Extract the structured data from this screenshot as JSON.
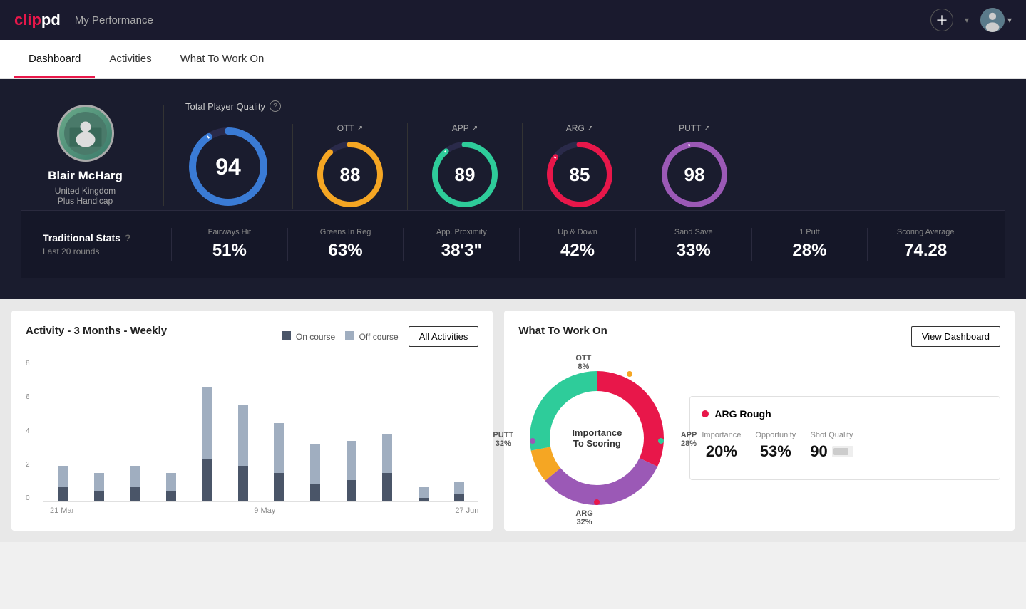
{
  "app": {
    "logo_text": "clippd",
    "logo_highlight": "clip",
    "header_title": "My Performance"
  },
  "nav": {
    "tabs": [
      "Dashboard",
      "Activities",
      "What To Work On"
    ],
    "active_tab": "Dashboard"
  },
  "player": {
    "name": "Blair McHarg",
    "country": "United Kingdom",
    "handicap": "Plus Handicap"
  },
  "quality": {
    "section_label": "Total Player Quality",
    "main_score": 94,
    "scores": [
      {
        "label": "OTT",
        "value": 88,
        "color": "#f5a623",
        "track": "#3a3a3a"
      },
      {
        "label": "APP",
        "value": 89,
        "color": "#2ecc9a",
        "track": "#3a3a3a"
      },
      {
        "label": "ARG",
        "value": 85,
        "color": "#e8174a",
        "track": "#3a3a3a"
      },
      {
        "label": "PUTT",
        "value": 98,
        "color": "#9b59b6",
        "track": "#3a3a3a"
      }
    ]
  },
  "traditional_stats": {
    "title": "Traditional Stats",
    "subtitle": "Last 20 rounds",
    "stats": [
      {
        "label": "Fairways Hit",
        "value": "51%"
      },
      {
        "label": "Greens In Reg",
        "value": "63%"
      },
      {
        "label": "App. Proximity",
        "value": "38'3\""
      },
      {
        "label": "Up & Down",
        "value": "42%"
      },
      {
        "label": "Sand Save",
        "value": "33%"
      },
      {
        "label": "1 Putt",
        "value": "28%"
      },
      {
        "label": "Scoring Average",
        "value": "74.28"
      }
    ]
  },
  "activity_chart": {
    "title": "Activity - 3 Months - Weekly",
    "legend_on_course": "On course",
    "legend_off_course": "Off course",
    "all_activities_label": "All Activities",
    "x_labels": [
      "21 Mar",
      "9 May",
      "27 Jun"
    ],
    "y_labels": [
      "8",
      "6",
      "4",
      "2",
      "0"
    ],
    "bars": [
      {
        "dark": 20,
        "light": 30
      },
      {
        "dark": 15,
        "light": 25
      },
      {
        "dark": 20,
        "light": 30
      },
      {
        "dark": 15,
        "light": 25
      },
      {
        "dark": 60,
        "light": 100
      },
      {
        "dark": 50,
        "light": 85
      },
      {
        "dark": 40,
        "light": 70
      },
      {
        "dark": 25,
        "light": 55
      },
      {
        "dark": 30,
        "light": 55
      },
      {
        "dark": 40,
        "light": 55
      },
      {
        "dark": 5,
        "light": 15
      },
      {
        "dark": 10,
        "light": 18
      }
    ]
  },
  "what_to_work_on": {
    "title": "What To Work On",
    "view_dashboard_label": "View Dashboard",
    "donut_center_line1": "Importance",
    "donut_center_line2": "To Scoring",
    "segments": [
      {
        "label": "OTT",
        "pct": "8%",
        "color": "#f5a623",
        "value": 8
      },
      {
        "label": "APP",
        "pct": "28%",
        "color": "#2ecc9a",
        "value": 28
      },
      {
        "label": "ARG",
        "pct": "32%",
        "color": "#e8174a",
        "value": 32
      },
      {
        "label": "PUTT",
        "pct": "32%",
        "color": "#9b59b6",
        "value": 32
      }
    ],
    "card": {
      "title": "ARG Rough",
      "importance_label": "Importance",
      "importance_value": "20%",
      "opportunity_label": "Opportunity",
      "opportunity_value": "53%",
      "shot_quality_label": "Shot Quality",
      "shot_quality_value": "90"
    }
  }
}
